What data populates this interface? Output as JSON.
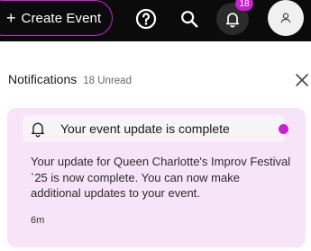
{
  "topbar": {
    "create_event_label": "Create Event",
    "create_event_icon": "plus-icon",
    "help_icon": "question-circle-icon",
    "search_icon": "search-icon",
    "notifications_icon": "bell-icon",
    "notifications_badge": "18",
    "avatar_icon": "user-icon",
    "accent_color": "#c81fd0"
  },
  "notifications": {
    "title": "Notifications",
    "unread_count": "18 Unread",
    "close_icon": "close-icon",
    "items": [
      {
        "title": "Your event update is complete",
        "body": "Your update for Queen Charlotte's Improv Festival `25 is now complete. You can now make additional updates to your event.",
        "time": "6m",
        "icon": "bell-icon",
        "unread": true
      }
    ]
  }
}
